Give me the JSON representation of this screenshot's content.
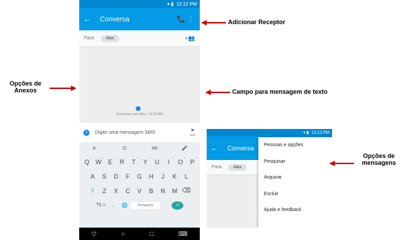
{
  "phone1": {
    "status": {
      "time": "12:12 PM",
      "icons": "▾ ▮"
    },
    "appbar": {
      "back_icon": "←",
      "title": "Conversa",
      "call_icon": "📞",
      "menu_icon": "⋮"
    },
    "to": {
      "label": "Para",
      "contact": "Alex",
      "add_person_icon": "+👥"
    },
    "conversation": {
      "note": "Conversa com Alex • 11:03 AM"
    },
    "compose": {
      "plus_icon": "+",
      "placeholder": "Digite uma mensagem SMS",
      "send_icon": "➤",
      "send_sub": "SMS"
    },
    "keyboard": {
      "suggestions": [
        "A",
        "O",
        "Att",
        "🎤"
      ],
      "row1": [
        "Q",
        "W",
        "E",
        "R",
        "T",
        "Y",
        "U",
        "I",
        "O",
        "P"
      ],
      "row1_num": [
        "1",
        "2",
        "3",
        "4",
        "5",
        "6",
        "7",
        "8",
        "9",
        "0"
      ],
      "row2": [
        "A",
        "S",
        "D",
        "F",
        "G",
        "H",
        "J",
        "K",
        "L"
      ],
      "row3": [
        "⇧",
        "Z",
        "X",
        "C",
        "V",
        "B",
        "N",
        "M",
        "⌫"
      ],
      "row4_sym": "?1☺",
      "row4_comma": ",",
      "row4_globe": "🌐",
      "space_label": "Português",
      "row4_period": ".",
      "enter_icon": "☺"
    },
    "navbar": [
      "▽",
      "○",
      "□",
      "⌨"
    ]
  },
  "phone2": {
    "status": {
      "time": "12:12 PM",
      "icons": "▾ ▮"
    },
    "appbar": {
      "back_icon": "←",
      "title": "Conversa"
    },
    "to": {
      "label": "Para",
      "contact": "Alex"
    },
    "menu": [
      "Pessoas e opções",
      "Pesquisar",
      "Arquivar",
      "Excluir",
      "Ajuda e feedback"
    ]
  },
  "annotations": {
    "receptor": "Adicionar Receptor",
    "anexos_1": "Opções de",
    "anexos_2": "Anexos",
    "campo": "Campo para mensagem de texto",
    "msg_1": "Opções de",
    "msg_2": "mensagens"
  },
  "colors": {
    "statusbar": "#0288d1",
    "appbar": "#039be5",
    "arrow": "#cc0000",
    "accent": "#1e88e5"
  }
}
